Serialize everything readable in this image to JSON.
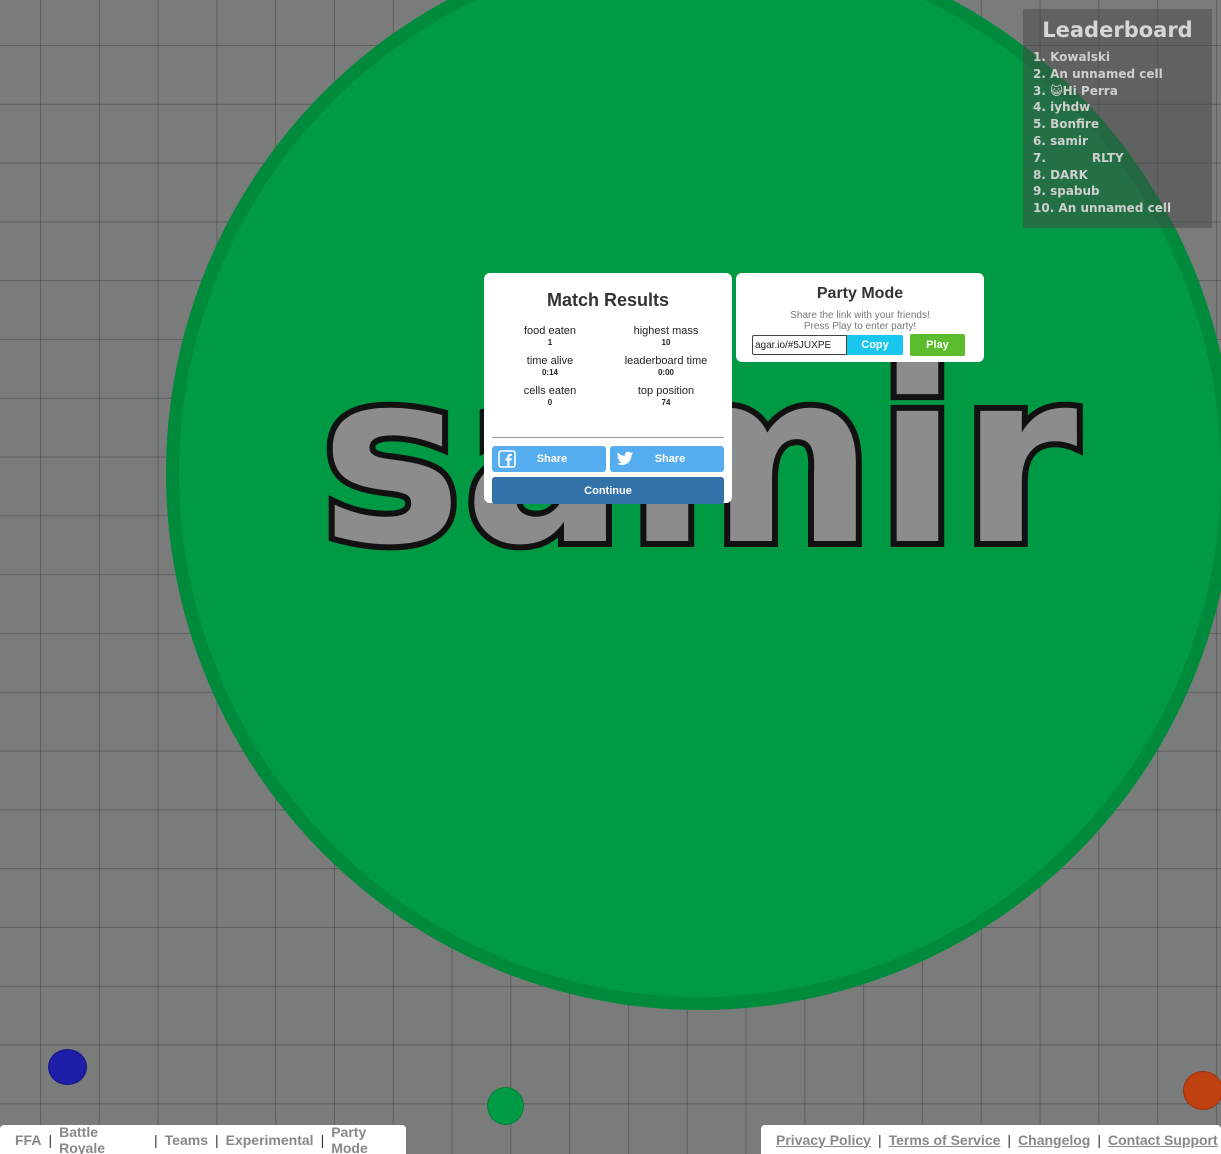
{
  "player": {
    "name": "samir",
    "cell_color": "#009a44"
  },
  "leaderboard": {
    "title": "Leaderboard",
    "entries": [
      "1. Kowalski",
      "2. An unnamed cell",
      "3. 😺Hi Perra",
      "4. iyhdw",
      "5. Bonfire",
      "6. samir",
      "7.           RLTY",
      "8. DARK",
      "9. spabub",
      "10. An unnamed cell"
    ]
  },
  "match_results": {
    "title": "Match Results",
    "stats": {
      "food_eaten_label": "food eaten",
      "food_eaten_value": "1",
      "highest_mass_label": "highest mass",
      "highest_mass_value": "10",
      "time_alive_label": "time alive",
      "time_alive_value": "0:14",
      "leaderboard_time_label": "leaderboard time",
      "leaderboard_time_value": "0:00",
      "cells_eaten_label": "cells eaten",
      "cells_eaten_value": "0",
      "top_position_label": "top position",
      "top_position_value": "74"
    },
    "facebook_share_label": "Share",
    "twitter_share_label": "Share",
    "continue_label": "Continue"
  },
  "party_mode": {
    "title": "Party Mode",
    "subtitle_line1": "Share the link with your friends!",
    "subtitle_line2": "Press Play to enter party!",
    "link_value": "agar.io/#5JUXPE",
    "copy_label": "Copy",
    "play_label": "Play"
  },
  "footer_left": {
    "links": [
      "FFA",
      "Battle Royale",
      "Teams",
      "Experimental",
      "Party Mode"
    ]
  },
  "footer_right": {
    "links": [
      "Privacy Policy",
      "Terms of Service",
      "Changelog",
      "Contact Support"
    ]
  },
  "colors": {
    "background": "#7a7c7c",
    "player_cell": "#009a44",
    "blue_cell": "#1e1ea8",
    "orange_cell": "#c04010",
    "copy_button": "#18c6ee",
    "play_button": "#5bbd2b",
    "continue_button": "#3372a8",
    "share_button": "#55acee"
  }
}
